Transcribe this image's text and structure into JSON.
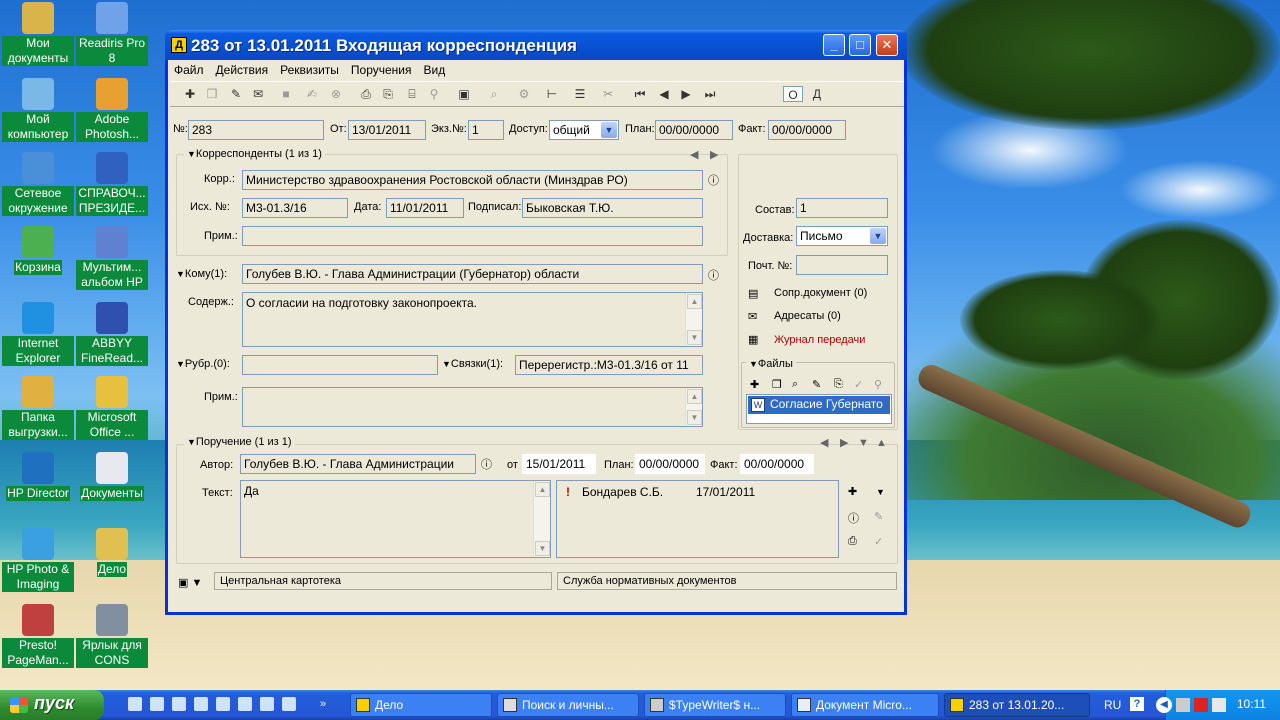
{
  "desktop": {
    "icons": [
      {
        "label": "Мои документы",
        "name": "my-documents"
      },
      {
        "label": "Readiris Pro 8",
        "name": "readiris-pro"
      },
      {
        "label": "Мой компьютер",
        "name": "my-computer"
      },
      {
        "label": "Adobe Photosh...",
        "name": "adobe-photoshop"
      },
      {
        "label": "Сетевое окружение",
        "name": "network-places"
      },
      {
        "label": "СПРАВОЧ... ПРЕЗИДЕ...",
        "name": "spravoch-prezide"
      },
      {
        "label": "Корзина",
        "name": "recycle-bin"
      },
      {
        "label": "Мультим... альбом HP",
        "name": "multimedia-album-hp"
      },
      {
        "label": "Internet Explorer",
        "name": "internet-explorer"
      },
      {
        "label": "ABBYY FineRead...",
        "name": "abbyy-finereader"
      },
      {
        "label": "Папка выгрузки...",
        "name": "export-folder"
      },
      {
        "label": "Microsoft Office ...",
        "name": "microsoft-office"
      },
      {
        "label": "HP Director",
        "name": "hp-director"
      },
      {
        "label": "Документы",
        "name": "documents"
      },
      {
        "label": "HP Photo & Imaging",
        "name": "hp-photo-imaging"
      },
      {
        "label": "Дело",
        "name": "delo"
      },
      {
        "label": "Presto! PageMan...",
        "name": "presto-pageman"
      },
      {
        "label": "Ярлык для CONS",
        "name": "cons-shortcut"
      }
    ]
  },
  "window": {
    "app_icon_letter": "Д",
    "title": "283 от 13.01.2011 Входящая корреспонденция",
    "menu": [
      "Файл",
      "Действия",
      "Реквизиты",
      "Поручения",
      "Вид"
    ],
    "view_toggle": [
      "О",
      "Д"
    ],
    "header": {
      "num_label": "№:",
      "num_value": "283",
      "date_label": "От:",
      "date_value": "13/01/2011",
      "copy_label": "Экз.№:",
      "copy_value": "1",
      "access_label": "Доступ:",
      "access_value": "общий",
      "plan_label": "План:",
      "plan_value": "00/00/0000",
      "fact_label": "Факт:",
      "fact_value": "00/00/0000"
    },
    "correspondents": {
      "header": "Корреспонденты (1 из 1)",
      "corr_label": "Корр.:",
      "corr_value": "Министерство здравоохранения Ростовской области (Минздрав РО)",
      "out_label": "Исх. №:",
      "out_value": "М3-01.3/16",
      "date_label": "Дата:",
      "date_value": "11/01/2011",
      "signed_label": "Подписал:",
      "signed_value": "Быковская  Т.Ю.",
      "note_label": "Прим.:",
      "note_value": ""
    },
    "side": {
      "composition_label": "Состав:",
      "composition_value": "1",
      "delivery_label": "Доставка:",
      "delivery_value": "Письмо",
      "post_label": "Почт. №:",
      "post_value": "",
      "links": [
        "Сопр.документ (0)",
        "Адресаты (0)",
        "Журнал передачи"
      ],
      "files_header": "Файлы",
      "files": [
        "Согласие Губернато"
      ]
    },
    "to": {
      "label": "Кому(1):",
      "value": "Голубев В.Ю. - Глава Администрации (Губернатор) области"
    },
    "content": {
      "label": "Содерж.:",
      "value": "О согласии на подготовку законопроекта."
    },
    "rubric": {
      "label": "Рубр.(0):",
      "value": "",
      "links_label": "Связки(1):",
      "links_value": "Перерегистр.:М3-01.3/16 от 11"
    },
    "note2": {
      "label": "Прим.:",
      "value": ""
    },
    "assignment": {
      "header": "Поручение (1 из 1)",
      "author_label": "Автор:",
      "author_value": "Голубев В.Ю. - Глава Администрации",
      "from_label": "от",
      "from_value": "15/01/2011",
      "plan_label": "План:",
      "plan_value": "00/00/0000",
      "fact_label": "Факт:",
      "fact_value": "00/00/0000",
      "text_label": "Текст:",
      "text_value": "Да",
      "executors": [
        {
          "mark": "!",
          "name": "Бондарев С.Б.",
          "date": "17/01/2011"
        }
      ]
    },
    "status": [
      "Центральная картотека",
      "Служба нормативных документов"
    ]
  },
  "taskbar": {
    "start": "пуск",
    "tasks": [
      {
        "label": "Дело",
        "active": false
      },
      {
        "label": "Поиск и личны...",
        "active": false
      },
      {
        "label": "$TypeWriter$ н...",
        "active": false
      },
      {
        "label": "Документ Micro...",
        "active": false
      },
      {
        "label": "283 от 13.01.20...",
        "active": true
      }
    ],
    "lang": "RU",
    "clock": "10:11"
  },
  "colors": {
    "title_blue": "#0a5ae0",
    "window_bg": "#ece9d8",
    "taskbar_blue": "#245ed8",
    "start_green": "#2e8b2e"
  }
}
